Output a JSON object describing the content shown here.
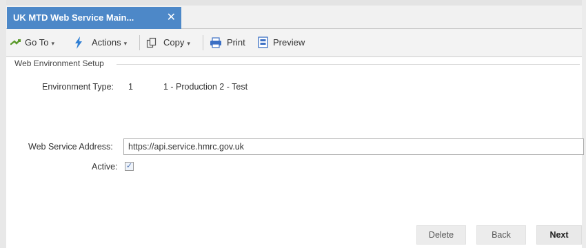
{
  "tab": {
    "title": "UK MTD Web Service Main...",
    "close_glyph": "✕"
  },
  "toolbar": {
    "goto_label": "Go To",
    "actions_label": "Actions",
    "copy_label": "Copy",
    "print_label": "Print",
    "preview_label": "Preview",
    "caret": "▾",
    "icons": [
      "arrow-goto-icon",
      "lightning-icon",
      "copy-icon",
      "printer-icon",
      "preview-icon"
    ]
  },
  "section": {
    "title": "Web Environment Setup"
  },
  "environment": {
    "label": "Environment Type:",
    "value": "1",
    "hint": "1 - Production 2 - Test"
  },
  "web_service": {
    "label": "Web Service Address:",
    "value": "https://api.service.hmrc.gov.uk"
  },
  "active": {
    "label": "Active:",
    "checked": true,
    "check_glyph": "✓"
  },
  "buttons": {
    "delete": "Delete",
    "back": "Back",
    "next": "Next"
  },
  "colors": {
    "tab_bg": "#4d88c8",
    "goto_icon": "#5a9a2a",
    "actions_icon": "#2f7fd4",
    "print_icon": "#3a6fc4"
  }
}
